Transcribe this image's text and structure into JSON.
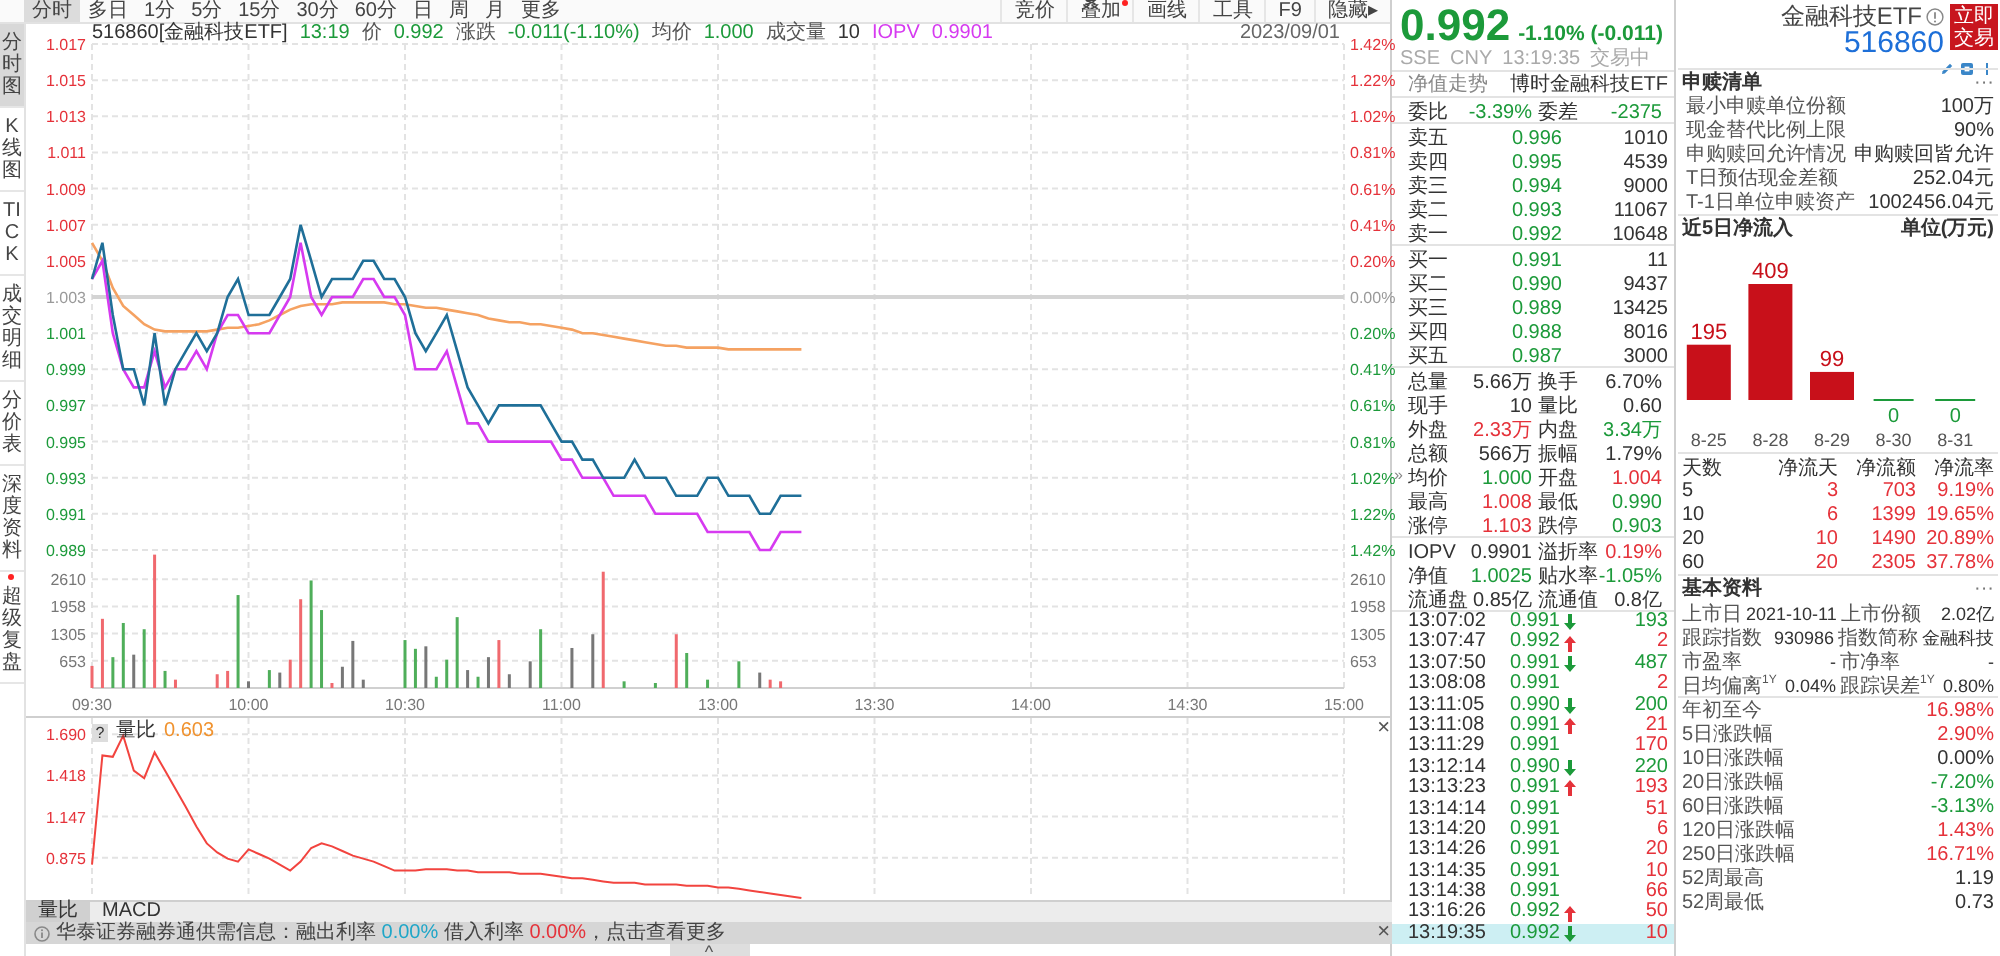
{
  "toolbar": {
    "tabs": [
      {
        "label": "分时",
        "selected": true
      },
      {
        "label": "多日",
        "selected": false
      },
      {
        "label": "1分",
        "selected": false
      },
      {
        "label": "5分",
        "selected": false
      },
      {
        "label": "15分",
        "selected": false
      },
      {
        "label": "30分",
        "selected": false
      },
      {
        "label": "60分",
        "selected": false
      },
      {
        "label": "日",
        "selected": false
      },
      {
        "label": "周",
        "selected": false
      },
      {
        "label": "月",
        "selected": false
      },
      {
        "label": "更多",
        "selected": false
      }
    ],
    "tools": [
      {
        "label": "竞价",
        "dot": false
      },
      {
        "label": "叠加",
        "dot": true
      },
      {
        "label": "画线",
        "dot": false
      },
      {
        "label": "工具",
        "dot": false
      },
      {
        "label": "F9",
        "dot": false
      },
      {
        "label": "隐藏▸",
        "dot": false
      }
    ]
  },
  "sidebar": {
    "items": [
      {
        "label": "分时图",
        "selected": true,
        "dot": false
      },
      {
        "label": "K线图",
        "selected": false,
        "dot": false
      },
      {
        "label": "TICK",
        "selected": false,
        "dot": false
      },
      {
        "label": "成交明细",
        "selected": false,
        "dot": false
      },
      {
        "label": "分价表",
        "selected": false,
        "dot": false
      },
      {
        "label": "深度资料",
        "selected": false,
        "dot": false
      },
      {
        "label": "超级复盘",
        "selected": false,
        "dot": true
      }
    ]
  },
  "price_chart": {
    "symbol": "516860[金融科技ETF]",
    "time": {
      "text": "13:19",
      "color": "#1c9a3a"
    },
    "fields": [
      {
        "label": {
          "text": "价"
        },
        "value": {
          "text": "0.992",
          "color": "#1c9a3a"
        }
      },
      {
        "label": {
          "text": "涨跌"
        },
        "value": {
          "text": "-0.011(-1.10%)",
          "color": "#1c9a3a"
        }
      },
      {
        "label": {
          "text": "均价"
        },
        "value": {
          "text": "1.000",
          "color": "#1c9a3a"
        }
      },
      {
        "label": {
          "text": "成交量"
        },
        "value": {
          "text": "10"
        }
      },
      {
        "label": {
          "text": "IOPV",
          "color": "#d63af0"
        },
        "value": {
          "text": "0.9901",
          "color": "#d63af0"
        }
      }
    ],
    "date": "2023/09/01",
    "percent_labels": [
      "1.42%",
      "1.22%",
      "1.02%",
      "0.81%",
      "0.61%",
      "0.41%",
      "0.20%",
      "0.00%",
      "0.20%",
      "0.41%",
      "0.61%",
      "0.81%",
      "1.02%",
      "1.22%",
      "1.42%"
    ],
    "chart_data": {
      "type": "line",
      "categories": [
        null,
        null,
        null,
        null,
        null,
        null,
        null,
        null,
        null,
        null,
        null,
        null,
        null,
        null,
        null,
        null,
        null,
        null,
        null,
        null,
        null,
        null,
        null,
        null,
        null,
        null,
        null,
        null,
        null,
        null,
        null,
        null,
        null,
        null,
        null,
        null,
        null,
        null,
        null,
        null,
        null,
        null,
        null,
        null,
        null,
        null,
        null,
        null,
        null,
        null,
        null,
        null,
        null,
        null,
        null,
        null,
        null,
        null,
        null,
        null,
        null,
        null,
        null,
        null,
        null,
        null,
        null,
        null,
        null,
        null,
        null,
        null,
        null,
        null,
        null,
        null,
        null,
        null,
        null,
        null,
        null,
        null,
        null,
        null,
        null,
        null,
        null,
        null,
        null,
        null,
        null,
        null,
        null,
        null,
        null,
        null,
        null,
        null,
        null,
        null,
        null,
        null,
        null,
        null,
        null,
        null,
        null,
        null,
        null,
        null,
        null,
        null,
        null,
        null,
        null,
        null,
        null,
        null,
        null,
        null,
        null
      ],
      "grid": true,
      "ylim": [
        0.989,
        1.017
      ],
      "yticks": [
        1.017,
        1.015,
        1.013,
        1.011,
        1.009,
        1.007,
        1.005,
        1.003,
        1.001,
        0.999,
        0.997,
        0.995,
        0.993,
        0.991,
        0.989
      ],
      "ref_lines": [
        {
          "axis": "y",
          "value": 1.003
        }
      ],
      "series": [
        {
          "color": "#f5a262",
          "values": [
            1.006,
            1.005,
            1.0035,
            1.0025,
            1.002,
            1.0015,
            1.0012,
            1.0011,
            1.0011,
            1.0011,
            1.0011,
            1.0011,
            1.0012,
            1.0013,
            1.0013,
            1.0014,
            1.0015,
            1.0017,
            1.002,
            1.0023,
            1.0025,
            1.0026,
            1.0026,
            1.0026,
            1.0027,
            1.0027,
            1.0027,
            1.0027,
            1.0027,
            1.0026,
            1.0026,
            1.0025,
            1.0024,
            1.0024,
            1.0023,
            1.0022,
            1.0021,
            1.002,
            1.0018,
            1.0017,
            1.0016,
            1.0016,
            1.0015,
            1.0015,
            1.0014,
            1.0013,
            1.0012,
            1.001,
            1.001,
            1.0009,
            1.0008,
            1.0007,
            1.0006,
            1.0005,
            1.0004,
            1.0003,
            1.0003,
            1.0002,
            1.0002,
            1.0002,
            1.0002,
            1.0001,
            1.0001,
            1.0001,
            1.0001,
            1.0001,
            1.0001,
            1.0001,
            1.0001,
            null,
            null,
            null,
            null,
            null,
            null,
            null,
            null,
            null,
            null,
            null,
            null,
            null,
            null,
            null,
            null,
            null,
            null,
            null,
            null,
            null,
            null,
            null,
            null,
            null,
            null,
            null,
            null,
            null,
            null,
            null,
            null,
            null,
            null,
            null,
            null,
            null,
            null,
            null,
            null,
            null,
            null,
            null,
            null,
            null,
            null,
            null,
            null,
            null,
            null,
            null,
            null
          ]
        },
        {
          "color": "#d63af0",
          "values": [
            1.004,
            1.005,
            1.001,
            0.999,
            0.998,
            0.998,
            1.0,
            0.998,
            0.999,
            0.999,
            1.0,
            0.999,
            1.001,
            1.002,
            1.002,
            1.001,
            1.001,
            1.001,
            1.002,
            1.003,
            1.006,
            1.003,
            1.002,
            1.003,
            1.003,
            1.003,
            1.004,
            1.004,
            1.003,
            1.003,
            1.002,
            0.999,
            0.999,
            0.999,
            1.0,
            0.998,
            0.996,
            0.996,
            0.995,
            0.995,
            0.995,
            0.995,
            0.995,
            0.995,
            0.995,
            0.994,
            0.994,
            0.993,
            0.993,
            0.993,
            0.992,
            0.992,
            0.992,
            0.992,
            0.991,
            0.991,
            0.991,
            0.991,
            0.991,
            0.99,
            0.99,
            0.99,
            0.99,
            0.99,
            0.989,
            0.989,
            0.99,
            0.99,
            0.99,
            null,
            null,
            null,
            null,
            null,
            null,
            null,
            null,
            null,
            null,
            null,
            null,
            null,
            null,
            null,
            null,
            null,
            null,
            null,
            null,
            null,
            null,
            null,
            null,
            null,
            null,
            null,
            null,
            null,
            null,
            null,
            null,
            null,
            null,
            null,
            null,
            null,
            null,
            null,
            null,
            null,
            null,
            null,
            null,
            null,
            null,
            null,
            null,
            null,
            null,
            null,
            null
          ]
        },
        {
          "color": "#1f6f98",
          "values": [
            1.004,
            1.006,
            1.002,
            0.999,
            0.999,
            0.997,
            1.001,
            0.997,
            0.999,
            1.0,
            1.001,
            1.0,
            1.001,
            1.003,
            1.004,
            1.002,
            1.002,
            1.002,
            1.003,
            1.004,
            1.007,
            1.005,
            1.003,
            1.004,
            1.004,
            1.004,
            1.005,
            1.005,
            1.004,
            1.004,
            1.003,
            1.001,
            1.0,
            1.001,
            1.002,
            1.0,
            0.998,
            0.997,
            0.996,
            0.997,
            0.997,
            0.997,
            0.997,
            0.997,
            0.996,
            0.995,
            0.995,
            0.994,
            0.994,
            0.993,
            0.993,
            0.993,
            0.994,
            0.993,
            0.993,
            0.993,
            0.992,
            0.992,
            0.992,
            0.993,
            0.993,
            0.992,
            0.992,
            0.992,
            0.991,
            0.991,
            0.992,
            0.992,
            0.992,
            null,
            null,
            null,
            null,
            null,
            null,
            null,
            null,
            null,
            null,
            null,
            null,
            null,
            null,
            null,
            null,
            null,
            null,
            null,
            null,
            null,
            null,
            null,
            null,
            null,
            null,
            null,
            null,
            null,
            null,
            null,
            null,
            null,
            null,
            null,
            null,
            null,
            null,
            null,
            null,
            null,
            null,
            null,
            null,
            null,
            null,
            null,
            null,
            null,
            null,
            null,
            null
          ]
        }
      ]
    }
  },
  "volume_chart": {
    "right_axis_labels": [
      "2610",
      "1958",
      "1305",
      "653"
    ],
    "chart_data": {
      "type": "bar",
      "categories": [
        "09:30",
        null,
        null,
        null,
        null,
        null,
        null,
        null,
        null,
        null,
        null,
        null,
        null,
        null,
        null,
        "10:00",
        null,
        null,
        null,
        null,
        null,
        null,
        null,
        null,
        null,
        null,
        null,
        null,
        null,
        null,
        "10:30",
        null,
        null,
        null,
        null,
        null,
        null,
        null,
        null,
        null,
        null,
        null,
        null,
        null,
        null,
        "11:00",
        null,
        null,
        null,
        null,
        null,
        null,
        null,
        null,
        null,
        null,
        null,
        null,
        null,
        null,
        "13:00",
        null,
        null,
        null,
        null,
        null,
        null,
        null,
        null,
        null,
        null,
        null,
        null,
        null,
        null,
        "13:30",
        null,
        null,
        null,
        null,
        null,
        null,
        null,
        null,
        null,
        null,
        null,
        null,
        null,
        null,
        "14:00",
        null,
        null,
        null,
        null,
        null,
        null,
        null,
        null,
        null,
        null,
        null,
        null,
        null,
        null,
        "14:30",
        null,
        null,
        null,
        null,
        null,
        null,
        null,
        null,
        null,
        null,
        null,
        null,
        null,
        null,
        "15:00"
      ],
      "grid": true,
      "ylim": [
        0,
        3263
      ],
      "yticks": [
        2610,
        1958,
        1305,
        653
      ],
      "series": [
        {
          "color": "#f0696e",
          "values": [
            530,
            1660,
            null,
            null,
            null,
            null,
            3200,
            null,
            200,
            null,
            null,
            null,
            330,
            410,
            null,
            null,
            null,
            null,
            null,
            680,
            2130,
            null,
            null,
            120,
            null,
            null,
            null,
            null,
            null,
            null,
            null,
            null,
            null,
            null,
            null,
            null,
            null,
            null,
            null,
            1150,
            null,
            null,
            null,
            null,
            null,
            null,
            null,
            null,
            null,
            2790,
            null,
            null,
            null,
            null,
            null,
            null,
            1290,
            null,
            null,
            null,
            null,
            null,
            null,
            null,
            null,
            200,
            160,
            null,
            null,
            null,
            null,
            null,
            null,
            null,
            null,
            null,
            null,
            null,
            null,
            null,
            null,
            null,
            null,
            null,
            null,
            null,
            null,
            null,
            null,
            null,
            null,
            null,
            null,
            null,
            null,
            null,
            null,
            null,
            null,
            null,
            null,
            null,
            null,
            null,
            null,
            null,
            null,
            null,
            null,
            null,
            null,
            null,
            null,
            null,
            null,
            null,
            null,
            null,
            null,
            null,
            null
          ]
        },
        {
          "color": "#4fae5a",
          "values": [
            null,
            null,
            740,
            1560,
            null,
            1410,
            null,
            410,
            null,
            null,
            null,
            null,
            null,
            null,
            2230,
            null,
            null,
            430,
            null,
            null,
            null,
            2580,
            1870,
            null,
            null,
            null,
            null,
            null,
            null,
            null,
            1150,
            940,
            null,
            270,
            680,
            1700,
            null,
            270,
            null,
            null,
            null,
            null,
            null,
            1410,
            null,
            null,
            null,
            null,
            null,
            null,
            null,
            160,
            null,
            null,
            120,
            null,
            null,
            840,
            null,
            200,
            null,
            null,
            640,
            null,
            null,
            null,
            null,
            null,
            null,
            null,
            null,
            null,
            null,
            null,
            null,
            null,
            null,
            null,
            null,
            null,
            null,
            null,
            null,
            null,
            null,
            null,
            null,
            null,
            null,
            null,
            null,
            null,
            null,
            null,
            null,
            null,
            null,
            null,
            null,
            null,
            null,
            null,
            null,
            null,
            null,
            null,
            null,
            null,
            null,
            null,
            null,
            null,
            null,
            null,
            null,
            null,
            null,
            null,
            null,
            null,
            null
          ]
        },
        {
          "color": "#777777",
          "values": [
            null,
            null,
            null,
            null,
            800,
            null,
            null,
            null,
            null,
            null,
            null,
            null,
            null,
            null,
            null,
            160,
            null,
            null,
            370,
            null,
            null,
            null,
            null,
            null,
            510,
            1130,
            200,
            null,
            null,
            null,
            null,
            null,
            1000,
            null,
            null,
            null,
            430,
            null,
            740,
            null,
            330,
            null,
            640,
            null,
            null,
            null,
            960,
            null,
            1290,
            null,
            null,
            null,
            null,
            null,
            null,
            null,
            null,
            null,
            null,
            null,
            null,
            null,
            null,
            null,
            370,
            null,
            null,
            null,
            null,
            null,
            null,
            null,
            null,
            null,
            null,
            null,
            null,
            null,
            null,
            null,
            null,
            null,
            null,
            null,
            null,
            null,
            null,
            null,
            null,
            null,
            null,
            null,
            null,
            null,
            null,
            null,
            null,
            null,
            null,
            null,
            null,
            null,
            null,
            null,
            null,
            null,
            null,
            null,
            null,
            null,
            null,
            null,
            null,
            null,
            null,
            null,
            null,
            null,
            null,
            null,
            null
          ]
        }
      ]
    }
  },
  "ratio_panel": {
    "help": "?",
    "title": "量比",
    "value": "0.603",
    "close": "×",
    "chart_data": {
      "type": "line",
      "categories": [
        null,
        null,
        null,
        null,
        null,
        null,
        null,
        null,
        null,
        null,
        null,
        null,
        null,
        null,
        null,
        null,
        null,
        null,
        null,
        null,
        null,
        null,
        null,
        null,
        null,
        null,
        null,
        null,
        null,
        null,
        null,
        null,
        null,
        null,
        null,
        null,
        null,
        null,
        null,
        null,
        null,
        null,
        null,
        null,
        null,
        null,
        null,
        null,
        null,
        null,
        null,
        null,
        null,
        null,
        null,
        null,
        null,
        null,
        null,
        null,
        null,
        null,
        null,
        null,
        null,
        null,
        null,
        null,
        null,
        null,
        null,
        null,
        null,
        null,
        null,
        null,
        null,
        null,
        null,
        null,
        null,
        null,
        null,
        null,
        null,
        null,
        null,
        null,
        null,
        null,
        null,
        null,
        null,
        null,
        null,
        null,
        null,
        null,
        null,
        null,
        null,
        null,
        null,
        null,
        null,
        null,
        null,
        null,
        null,
        null,
        null,
        null,
        null,
        null,
        null,
        null,
        null,
        null,
        null,
        null,
        null
      ],
      "grid": true,
      "ylim": [
        0.61,
        1.77
      ],
      "yticks": [
        {
          "value": 1.69,
          "label": "1.690"
        },
        1.418,
        1.147,
        0.875
      ],
      "series": [
        {
          "color": "#f2443f",
          "values": [
            0.83,
            1.55,
            1.54,
            1.68,
            1.45,
            1.4,
            1.57,
            1.45,
            1.33,
            1.21,
            1.08,
            0.97,
            0.91,
            0.87,
            0.85,
            0.93,
            0.9,
            0.87,
            0.83,
            0.79,
            0.85,
            0.94,
            0.97,
            0.95,
            0.92,
            0.89,
            0.87,
            0.85,
            0.82,
            0.79,
            0.79,
            0.79,
            0.8,
            0.8,
            0.8,
            0.79,
            0.79,
            0.78,
            0.78,
            0.78,
            0.78,
            0.77,
            0.77,
            0.77,
            0.76,
            0.75,
            0.74,
            0.74,
            0.73,
            0.72,
            0.71,
            0.71,
            0.71,
            0.7,
            0.7,
            0.7,
            0.7,
            0.69,
            0.69,
            0.69,
            0.68,
            0.68,
            0.67,
            0.66,
            0.65,
            0.64,
            0.63,
            0.62,
            0.61,
            null,
            null,
            null,
            null,
            null,
            null,
            null,
            null,
            null,
            null,
            null,
            null,
            null,
            null,
            null,
            null,
            null,
            null,
            null,
            null,
            null,
            null,
            null,
            null,
            null,
            null,
            null,
            null,
            null,
            null,
            null,
            null,
            null,
            null,
            null,
            null,
            null,
            null,
            null,
            null,
            null,
            null,
            null,
            null,
            null,
            null,
            null,
            null,
            null,
            null,
            null,
            null
          ]
        }
      ]
    }
  },
  "indicator_tabs": [
    {
      "label": "量比",
      "selected": true
    },
    {
      "label": "MACD",
      "selected": false
    }
  ],
  "info_bar": {
    "parts": [
      {
        "text": "华泰证券融券通供需信息：融出利率 "
      },
      {
        "text": "0.00%",
        "color": "#1fa6c8"
      },
      {
        "text": " 借入利率 "
      },
      {
        "text": "0.00%",
        "color": "#e5323a"
      },
      {
        "text": "，点击查看更多"
      }
    ],
    "close": "×"
  },
  "collapse_handle": "^",
  "quote": {
    "price": "0.992",
    "change": "-1.10% (-0.011)",
    "color": "#1c9a3a",
    "meta": [
      "SSE",
      "CNY",
      "13:19:35",
      "交易中"
    ],
    "expand_handle": "»",
    "nav_header": {
      "link": "净值走势",
      "fund": "博时金融科技ETF"
    },
    "order_ratio": [
      {
        "label": "委比",
        "value": "-3.39%",
        "color": "#1c9a3a"
      },
      {
        "label": "委差",
        "value": "-2375",
        "color": "#1c9a3a"
      }
    ],
    "asks": [
      {
        "label": "卖五",
        "price": "0.996",
        "volume": "1010",
        "color": "#1c9a3a"
      },
      {
        "label": "卖四",
        "price": "0.995",
        "volume": "4539",
        "color": "#1c9a3a"
      },
      {
        "label": "卖三",
        "price": "0.994",
        "volume": "9000",
        "color": "#1c9a3a"
      },
      {
        "label": "卖二",
        "price": "0.993",
        "volume": "11067",
        "color": "#1c9a3a"
      },
      {
        "label": "卖一",
        "price": "0.992",
        "volume": "10648",
        "color": "#1c9a3a"
      }
    ],
    "bids": [
      {
        "label": "买一",
        "price": "0.991",
        "volume": "11",
        "color": "#1c9a3a"
      },
      {
        "label": "买二",
        "price": "0.990",
        "volume": "9437",
        "color": "#1c9a3a"
      },
      {
        "label": "买三",
        "price": "0.989",
        "volume": "13425",
        "color": "#1c9a3a"
      },
      {
        "label": "买四",
        "price": "0.988",
        "volume": "8016",
        "color": "#1c9a3a"
      },
      {
        "label": "买五",
        "price": "0.987",
        "volume": "3000",
        "color": "#1c9a3a"
      }
    ],
    "stats": [
      [
        {
          "label": "总量",
          "value": "5.66万"
        },
        {
          "label": "换手",
          "value": "6.70%"
        }
      ],
      [
        {
          "label": "现手",
          "value": "10"
        },
        {
          "label": "量比",
          "value": "0.60"
        }
      ],
      [
        {
          "label": "外盘",
          "value": "2.33万",
          "color": "#e5323a"
        },
        {
          "label": "内盘",
          "value": "3.34万",
          "color": "#1c9a3a"
        }
      ],
      [
        {
          "label": "总额",
          "value": "566万"
        },
        {
          "label": "振幅",
          "value": "1.79%"
        }
      ],
      [
        {
          "label": "均价",
          "value": "1.000",
          "color": "#1c9a3a"
        },
        {
          "label": "开盘",
          "value": "1.004",
          "color": "#e5323a"
        }
      ],
      [
        {
          "label": "最高",
          "value": "1.008",
          "color": "#e5323a"
        },
        {
          "label": "最低",
          "value": "0.990",
          "color": "#1c9a3a"
        }
      ],
      [
        {
          "label": "涨停",
          "value": "1.103",
          "color": "#e5323a"
        },
        {
          "label": "跌停",
          "value": "0.903",
          "color": "#1c9a3a"
        }
      ]
    ],
    "nav": [
      [
        {
          "label": "IOPV",
          "value": "0.9901"
        },
        {
          "label": "溢折率",
          "value": "0.19%",
          "color": "#e5323a"
        }
      ],
      [
        {
          "label": "净值",
          "value": "1.0025",
          "color": "#1c9a3a"
        },
        {
          "label": "贴水率",
          "value": "-1.05%",
          "color": "#1c9a3a"
        }
      ],
      [
        {
          "label": "流通盘",
          "value": "0.85亿"
        },
        {
          "label": "流通值",
          "value": "0.8亿"
        }
      ]
    ],
    "ticks": [
      {
        "time": "13:07:02",
        "price": "0.991",
        "color": "#1c9a3a",
        "kind": "down",
        "volume": {
          "text": "193",
          "color": "#1c9a3a"
        },
        "selected": false
      },
      {
        "time": "13:07:47",
        "price": "0.992",
        "color": "#1c9a3a",
        "kind": "up",
        "volume": {
          "text": "2",
          "color": "#e5323a"
        },
        "selected": false
      },
      {
        "time": "13:07:50",
        "price": "0.991",
        "color": "#1c9a3a",
        "kind": "down",
        "volume": {
          "text": "487",
          "color": "#1c9a3a"
        },
        "selected": false
      },
      {
        "time": "13:08:08",
        "price": "0.991",
        "color": "#1c9a3a",
        "kind": "plain",
        "volume": {
          "text": "2",
          "color": "#e5323a"
        },
        "selected": false
      },
      {
        "time": "13:11:05",
        "price": "0.990",
        "color": "#1c9a3a",
        "kind": "down",
        "volume": {
          "text": "200",
          "color": "#1c9a3a"
        },
        "selected": false
      },
      {
        "time": "13:11:08",
        "price": "0.991",
        "color": "#1c9a3a",
        "kind": "up",
        "volume": {
          "text": "21",
          "color": "#e5323a"
        },
        "selected": false
      },
      {
        "time": "13:11:29",
        "price": "0.991",
        "color": "#1c9a3a",
        "kind": "plain",
        "volume": {
          "text": "170",
          "color": "#e5323a"
        },
        "selected": false
      },
      {
        "time": "13:12:14",
        "price": "0.990",
        "color": "#1c9a3a",
        "kind": "down",
        "volume": {
          "text": "220",
          "color": "#1c9a3a"
        },
        "selected": false
      },
      {
        "time": "13:13:23",
        "price": "0.991",
        "color": "#1c9a3a",
        "kind": "up",
        "volume": {
          "text": "193",
          "color": "#e5323a"
        },
        "selected": false
      },
      {
        "time": "13:14:14",
        "price": "0.991",
        "color": "#1c9a3a",
        "kind": "plain",
        "volume": {
          "text": "51",
          "color": "#e5323a"
        },
        "selected": false
      },
      {
        "time": "13:14:20",
        "price": "0.991",
        "color": "#1c9a3a",
        "kind": "plain",
        "volume": {
          "text": "6",
          "color": "#e5323a"
        },
        "selected": false
      },
      {
        "time": "13:14:26",
        "price": "0.991",
        "color": "#1c9a3a",
        "kind": "plain",
        "volume": {
          "text": "20",
          "color": "#e5323a"
        },
        "selected": false
      },
      {
        "time": "13:14:35",
        "price": "0.991",
        "color": "#1c9a3a",
        "kind": "plain",
        "volume": {
          "text": "10",
          "color": "#e5323a"
        },
        "selected": false
      },
      {
        "time": "13:14:38",
        "price": "0.991",
        "color": "#1c9a3a",
        "kind": "plain",
        "volume": {
          "text": "66",
          "color": "#e5323a"
        },
        "selected": false
      },
      {
        "time": "13:16:26",
        "price": "0.992",
        "color": "#1c9a3a",
        "kind": "up",
        "volume": {
          "text": "50",
          "color": "#e5323a"
        },
        "selected": false
      },
      {
        "time": "13:19:35",
        "price": "0.992",
        "color": "#1c9a3a",
        "kind": "down",
        "volume": {
          "text": "10",
          "color": "#e5323a"
        },
        "selected": true
      }
    ]
  },
  "fund_panel": {
    "name": "金融科技ETF",
    "code": "516860",
    "trade_button": "立即交易",
    "creation": {
      "title": "申赎清单",
      "more": "···",
      "rows": [
        {
          "label": "最小申赎单位份额",
          "value": "100万"
        },
        {
          "label": "现金替代比例上限",
          "value": "90%"
        },
        {
          "label": "申购赎回允许情况",
          "value": "申购赎回皆允许"
        },
        {
          "label": "T日预估现金差额",
          "value": "252.04元"
        },
        {
          "label": "T-1日单位申赎资产",
          "value": "1002456.04元"
        }
      ]
    },
    "flows": {
      "title": "近5日净流入",
      "unit": "单位(万元)",
      "chart_data": {
        "type": "bar",
        "categories": [
          "8-25",
          "8-28",
          "8-29",
          "8-30",
          "8-31"
        ],
        "series": [
          {
            "color": "#c8101a",
            "values": [
              195,
              409,
              99,
              0,
              0
            ]
          }
        ],
        "data_labels": true
      },
      "columns": [
        "天数",
        "净流天",
        "净流额",
        "净流率"
      ],
      "rows": [
        {
          "days": "5",
          "net_days": "3",
          "amount": "703",
          "rate": "9.19%",
          "color": "#e5323a"
        },
        {
          "days": "10",
          "net_days": "6",
          "amount": "1399",
          "rate": "19.65%",
          "color": "#e5323a"
        },
        {
          "days": "20",
          "net_days": "10",
          "amount": "1490",
          "rate": "20.89%",
          "color": "#e5323a"
        },
        {
          "days": "60",
          "net_days": "20",
          "amount": "2305",
          "rate": "37.78%",
          "color": "#e5323a"
        }
      ]
    },
    "basics": {
      "title": "基本资料",
      "more": "···",
      "rows": [
        [
          {
            "label": "上市日",
            "value": "2021-10-11"
          },
          {
            "label": "上市份额",
            "value": "2.02亿"
          }
        ],
        [
          {
            "label": "跟踪指数",
            "value": "930986"
          },
          {
            "label": "指数简称",
            "value": "金融科技"
          }
        ],
        [
          {
            "label": "市盈率",
            "value": "-"
          },
          {
            "label": "市净率",
            "value": "-"
          }
        ],
        [
          {
            "label": "日均偏离$^{1Y}$",
            "value": "0.04%"
          },
          {
            "label": "跟踪误差$^{1Y}$",
            "value": "0.80%"
          }
        ]
      ]
    },
    "performance": [
      {
        "label": "年初至今",
        "value": "16.98%",
        "color": "#e5323a"
      },
      {
        "label": "5日涨跌幅",
        "value": "2.90%",
        "color": "#e5323a"
      },
      {
        "label": "10日涨跌幅",
        "value": "0.00%"
      },
      {
        "label": "20日涨跌幅",
        "value": "-7.20%",
        "color": "#1c9a3a"
      },
      {
        "label": "60日涨跌幅",
        "value": "-3.13%",
        "color": "#1c9a3a"
      },
      {
        "label": "120日涨跌幅",
        "value": "1.43%",
        "color": "#e5323a"
      },
      {
        "label": "250日涨跌幅",
        "value": "16.71%",
        "color": "#e5323a"
      },
      {
        "label": "52周最高",
        "value": "1.19"
      },
      {
        "label": "52周最低",
        "value": "0.73"
      }
    ]
  }
}
